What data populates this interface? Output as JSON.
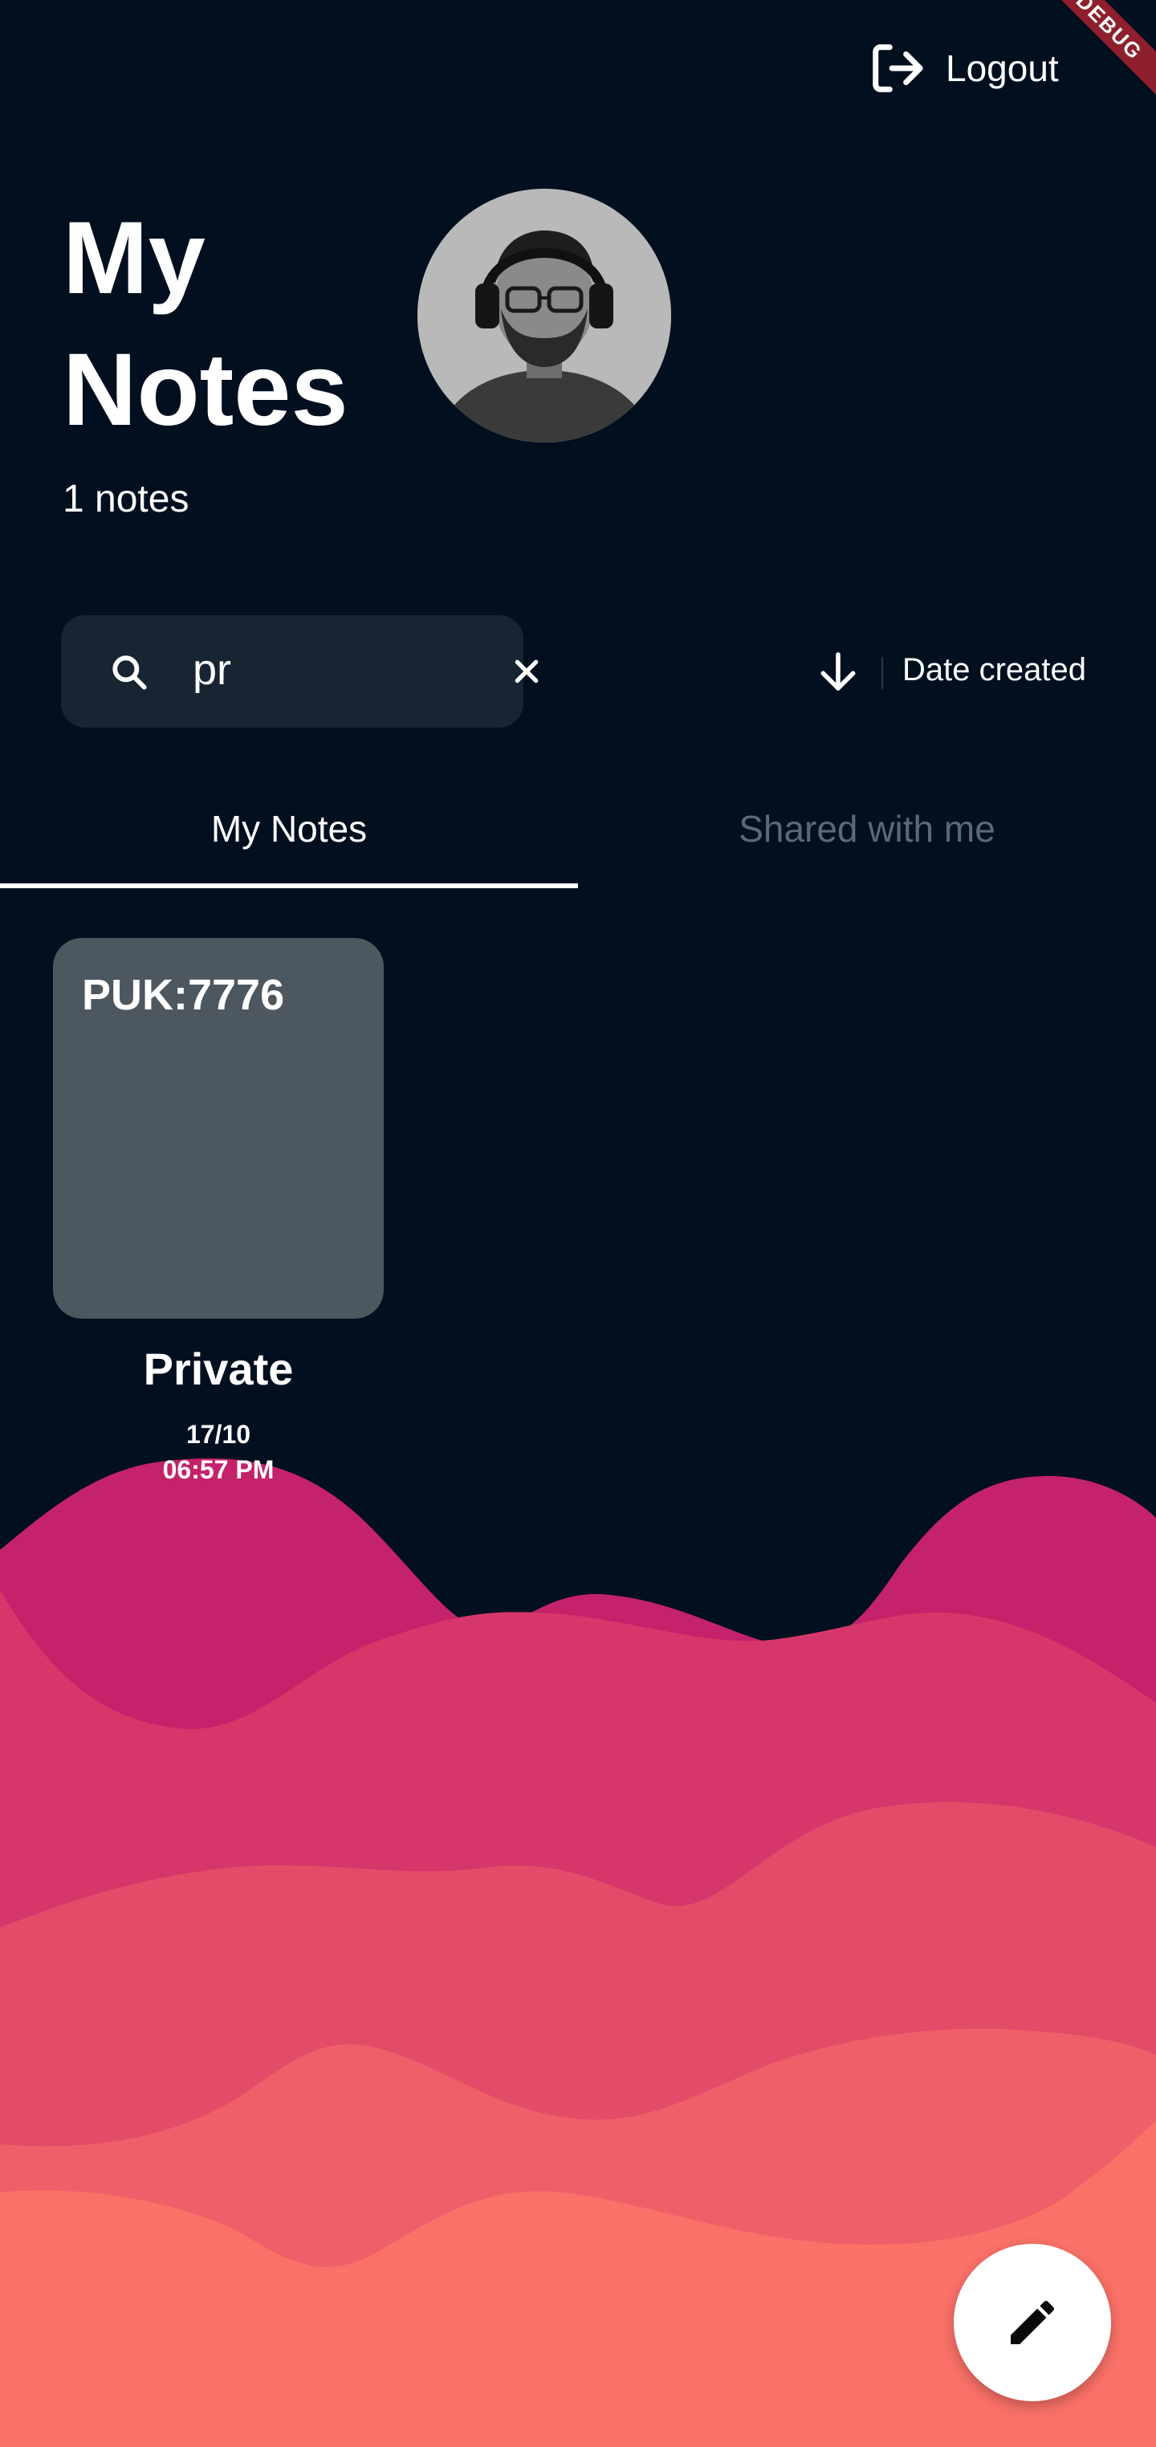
{
  "debug_banner": "DEBUG",
  "header": {
    "logout_label": "Logout",
    "logout_icon": "logout-icon"
  },
  "title": "My Notes",
  "note_count": "1 notes",
  "search": {
    "value": "pr",
    "search_icon": "search-icon",
    "clear_icon": "close-icon"
  },
  "sort": {
    "direction_icon": "arrow-down-icon",
    "label": "Date created"
  },
  "tabs": [
    {
      "label": "My Notes",
      "active": true
    },
    {
      "label": "Shared with me",
      "active": false
    }
  ],
  "notes": [
    {
      "title": "PUK:7776",
      "visibility": "Private",
      "date": "17/10",
      "time": "06:57 PM"
    }
  ],
  "fab": {
    "icon": "edit-pencil-icon"
  },
  "colors": {
    "background": "#020F1F",
    "search_bg": "#172431",
    "card_bg": "#4D5760",
    "tab_inactive": "#5D6874",
    "wave_1": "#C4226A",
    "wave_2": "#D5376A",
    "wave_3": "#E24C69",
    "wave_4": "#EF5F69",
    "wave_5": "#FA7168",
    "debug_ribbon": "#8E1F2C"
  }
}
